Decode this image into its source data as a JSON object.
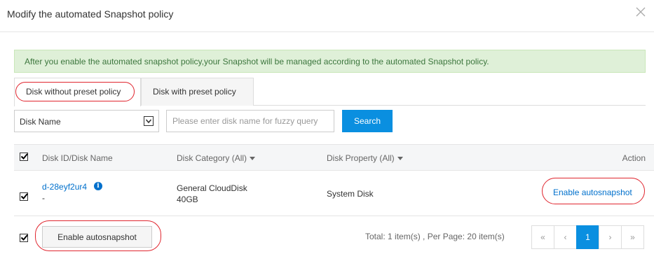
{
  "dialog": {
    "title": "Modify the automated Snapshot policy",
    "notice": "After you enable the automated snapshot policy,your Snapshot will be managed according to the automated Snapshot policy."
  },
  "tabs": [
    {
      "label": "Disk without preset policy",
      "active": true
    },
    {
      "label": "Disk with preset policy",
      "active": false
    }
  ],
  "filter": {
    "field": "Disk Name",
    "placeholder": "Please enter disk name for fuzzy query",
    "search_label": "Search"
  },
  "table": {
    "headers": {
      "id": "Disk ID/Disk Name",
      "category": "Disk Category (All)",
      "property": "Disk Property (All)",
      "action": "Action"
    },
    "rows": [
      {
        "disk_id": "d-28eyf2ur4",
        "disk_name": "-",
        "category": "General CloudDisk",
        "size": "40GB",
        "property": "System Disk",
        "action": "Enable autosnapshot",
        "checked": true
      }
    ]
  },
  "footer": {
    "bulk_button": "Enable autosnapshot",
    "total": "Total: 1 item(s) ,  Per Page: 20 item(s)",
    "pager": {
      "first": "«",
      "prev": "‹",
      "current": "1",
      "next": "›",
      "last": "»"
    }
  },
  "colors": {
    "accent": "#0a8fe0",
    "link": "#0070cc",
    "highlight_oval": "#e0262f",
    "notice_bg": "#dff0d8",
    "notice_text": "#3c763d"
  },
  "icons": {
    "close": "close-icon",
    "info": "info-icon",
    "dropdown": "chevron-down-icon",
    "sort": "caret-down-icon",
    "checkbox": "checkmark-icon"
  }
}
